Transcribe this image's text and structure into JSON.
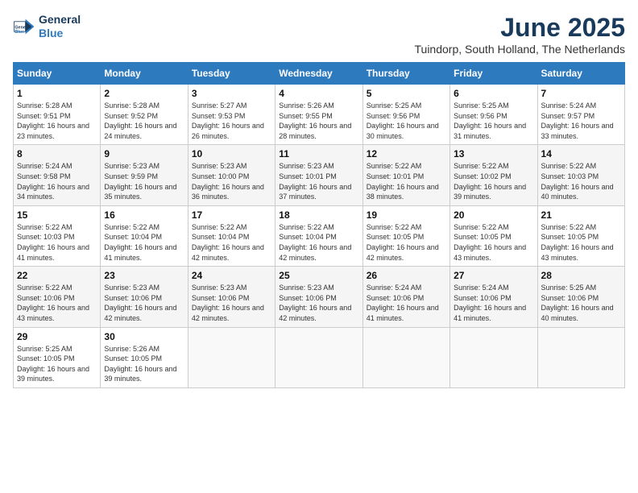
{
  "header": {
    "logo_line1": "General",
    "logo_line2": "Blue",
    "month_title": "June 2025",
    "location": "Tuindorp, South Holland, The Netherlands"
  },
  "weekdays": [
    "Sunday",
    "Monday",
    "Tuesday",
    "Wednesday",
    "Thursday",
    "Friday",
    "Saturday"
  ],
  "weeks": [
    [
      {
        "day": "1",
        "sunrise": "Sunrise: 5:28 AM",
        "sunset": "Sunset: 9:51 PM",
        "daylight": "Daylight: 16 hours and 23 minutes."
      },
      {
        "day": "2",
        "sunrise": "Sunrise: 5:28 AM",
        "sunset": "Sunset: 9:52 PM",
        "daylight": "Daylight: 16 hours and 24 minutes."
      },
      {
        "day": "3",
        "sunrise": "Sunrise: 5:27 AM",
        "sunset": "Sunset: 9:53 PM",
        "daylight": "Daylight: 16 hours and 26 minutes."
      },
      {
        "day": "4",
        "sunrise": "Sunrise: 5:26 AM",
        "sunset": "Sunset: 9:55 PM",
        "daylight": "Daylight: 16 hours and 28 minutes."
      },
      {
        "day": "5",
        "sunrise": "Sunrise: 5:25 AM",
        "sunset": "Sunset: 9:56 PM",
        "daylight": "Daylight: 16 hours and 30 minutes."
      },
      {
        "day": "6",
        "sunrise": "Sunrise: 5:25 AM",
        "sunset": "Sunset: 9:56 PM",
        "daylight": "Daylight: 16 hours and 31 minutes."
      },
      {
        "day": "7",
        "sunrise": "Sunrise: 5:24 AM",
        "sunset": "Sunset: 9:57 PM",
        "daylight": "Daylight: 16 hours and 33 minutes."
      }
    ],
    [
      {
        "day": "8",
        "sunrise": "Sunrise: 5:24 AM",
        "sunset": "Sunset: 9:58 PM",
        "daylight": "Daylight: 16 hours and 34 minutes."
      },
      {
        "day": "9",
        "sunrise": "Sunrise: 5:23 AM",
        "sunset": "Sunset: 9:59 PM",
        "daylight": "Daylight: 16 hours and 35 minutes."
      },
      {
        "day": "10",
        "sunrise": "Sunrise: 5:23 AM",
        "sunset": "Sunset: 10:00 PM",
        "daylight": "Daylight: 16 hours and 36 minutes."
      },
      {
        "day": "11",
        "sunrise": "Sunrise: 5:23 AM",
        "sunset": "Sunset: 10:01 PM",
        "daylight": "Daylight: 16 hours and 37 minutes."
      },
      {
        "day": "12",
        "sunrise": "Sunrise: 5:22 AM",
        "sunset": "Sunset: 10:01 PM",
        "daylight": "Daylight: 16 hours and 38 minutes."
      },
      {
        "day": "13",
        "sunrise": "Sunrise: 5:22 AM",
        "sunset": "Sunset: 10:02 PM",
        "daylight": "Daylight: 16 hours and 39 minutes."
      },
      {
        "day": "14",
        "sunrise": "Sunrise: 5:22 AM",
        "sunset": "Sunset: 10:03 PM",
        "daylight": "Daylight: 16 hours and 40 minutes."
      }
    ],
    [
      {
        "day": "15",
        "sunrise": "Sunrise: 5:22 AM",
        "sunset": "Sunset: 10:03 PM",
        "daylight": "Daylight: 16 hours and 41 minutes."
      },
      {
        "day": "16",
        "sunrise": "Sunrise: 5:22 AM",
        "sunset": "Sunset: 10:04 PM",
        "daylight": "Daylight: 16 hours and 41 minutes."
      },
      {
        "day": "17",
        "sunrise": "Sunrise: 5:22 AM",
        "sunset": "Sunset: 10:04 PM",
        "daylight": "Daylight: 16 hours and 42 minutes."
      },
      {
        "day": "18",
        "sunrise": "Sunrise: 5:22 AM",
        "sunset": "Sunset: 10:04 PM",
        "daylight": "Daylight: 16 hours and 42 minutes."
      },
      {
        "day": "19",
        "sunrise": "Sunrise: 5:22 AM",
        "sunset": "Sunset: 10:05 PM",
        "daylight": "Daylight: 16 hours and 42 minutes."
      },
      {
        "day": "20",
        "sunrise": "Sunrise: 5:22 AM",
        "sunset": "Sunset: 10:05 PM",
        "daylight": "Daylight: 16 hours and 43 minutes."
      },
      {
        "day": "21",
        "sunrise": "Sunrise: 5:22 AM",
        "sunset": "Sunset: 10:05 PM",
        "daylight": "Daylight: 16 hours and 43 minutes."
      }
    ],
    [
      {
        "day": "22",
        "sunrise": "Sunrise: 5:22 AM",
        "sunset": "Sunset: 10:06 PM",
        "daylight": "Daylight: 16 hours and 43 minutes."
      },
      {
        "day": "23",
        "sunrise": "Sunrise: 5:23 AM",
        "sunset": "Sunset: 10:06 PM",
        "daylight": "Daylight: 16 hours and 42 minutes."
      },
      {
        "day": "24",
        "sunrise": "Sunrise: 5:23 AM",
        "sunset": "Sunset: 10:06 PM",
        "daylight": "Daylight: 16 hours and 42 minutes."
      },
      {
        "day": "25",
        "sunrise": "Sunrise: 5:23 AM",
        "sunset": "Sunset: 10:06 PM",
        "daylight": "Daylight: 16 hours and 42 minutes."
      },
      {
        "day": "26",
        "sunrise": "Sunrise: 5:24 AM",
        "sunset": "Sunset: 10:06 PM",
        "daylight": "Daylight: 16 hours and 41 minutes."
      },
      {
        "day": "27",
        "sunrise": "Sunrise: 5:24 AM",
        "sunset": "Sunset: 10:06 PM",
        "daylight": "Daylight: 16 hours and 41 minutes."
      },
      {
        "day": "28",
        "sunrise": "Sunrise: 5:25 AM",
        "sunset": "Sunset: 10:06 PM",
        "daylight": "Daylight: 16 hours and 40 minutes."
      }
    ],
    [
      {
        "day": "29",
        "sunrise": "Sunrise: 5:25 AM",
        "sunset": "Sunset: 10:05 PM",
        "daylight": "Daylight: 16 hours and 39 minutes."
      },
      {
        "day": "30",
        "sunrise": "Sunrise: 5:26 AM",
        "sunset": "Sunset: 10:05 PM",
        "daylight": "Daylight: 16 hours and 39 minutes."
      },
      null,
      null,
      null,
      null,
      null
    ]
  ]
}
